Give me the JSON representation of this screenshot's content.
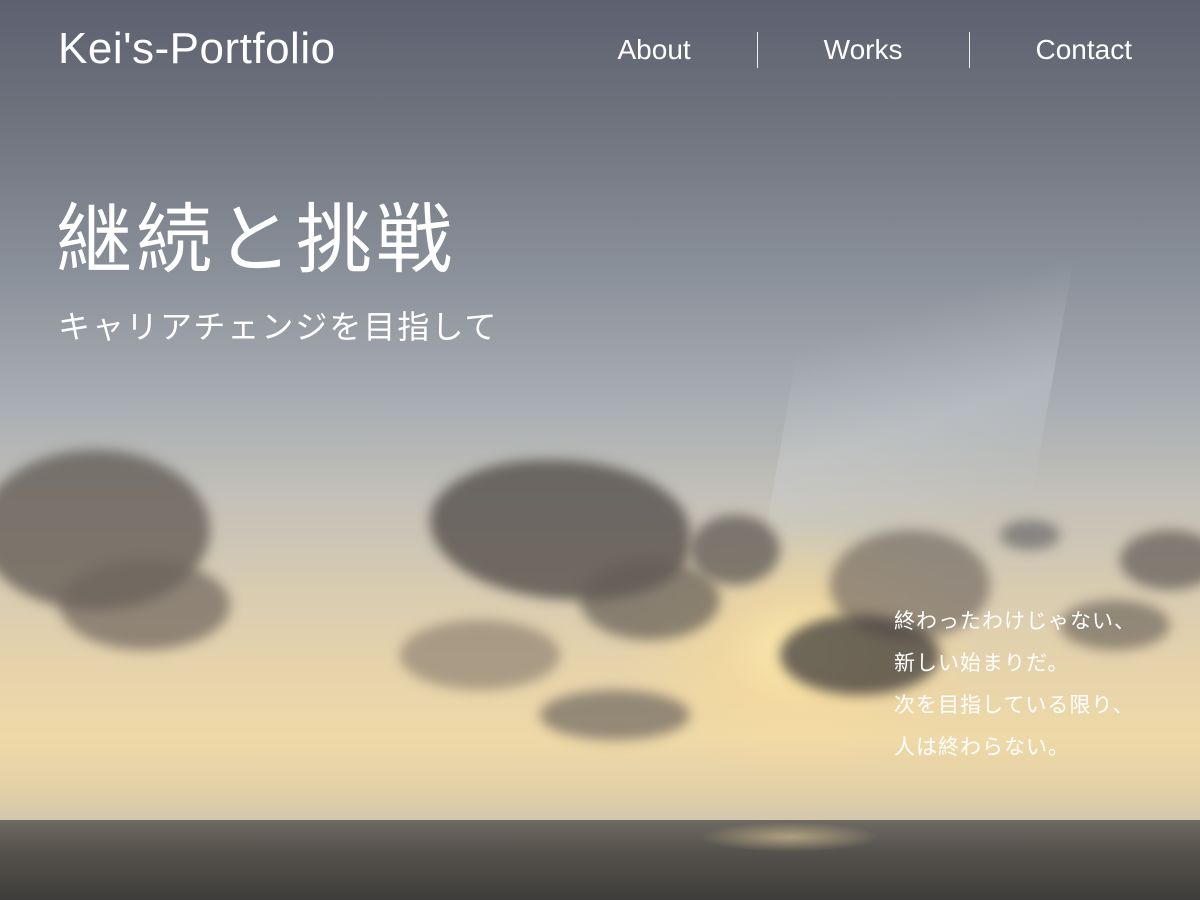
{
  "header": {
    "logo": "Kei's-Portfolio",
    "nav": [
      {
        "label": "About"
      },
      {
        "label": "Works"
      },
      {
        "label": "Contact"
      }
    ]
  },
  "hero": {
    "headline": "継続と挑戦",
    "subheadline": "キャリアチェンジを目指して",
    "poem": [
      "終わったわけじゃない、",
      "新しい始まりだ。",
      "次を目指している限り、",
      "人は終わらない。"
    ]
  }
}
